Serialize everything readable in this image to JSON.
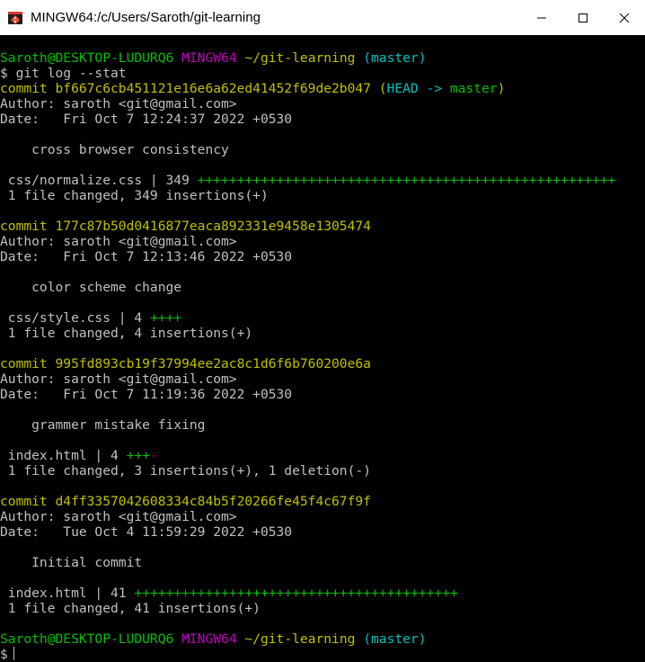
{
  "window": {
    "title": "MINGW64:/c/Users/Saroth/git-learning",
    "minimize_icon": "minimize-icon",
    "maximize_icon": "maximize-icon",
    "close_icon": "close-icon"
  },
  "colors": {
    "prompt_user": "#00c000",
    "prompt_shell": "#c000c0",
    "prompt_path": "#c0c000",
    "prompt_branch": "#00c0c0",
    "commit_hash": "#c0c000",
    "head_ref": "#00c0c0",
    "insertions": "#00c000",
    "deletions": "#c00000"
  },
  "prompt": {
    "user_host": "Saroth@DESKTOP-LUDURQ6",
    "shell": "MINGW64",
    "path": "~/git-learning",
    "branch": "(master)"
  },
  "command": "$ git log --stat",
  "head_label_open": "(",
  "head_label": "HEAD -> ",
  "head_branch": "master",
  "head_label_close": ")",
  "commits": [
    {
      "commit_line": "commit bf667c6cb451121e16e6a62ed41452f69de2b047",
      "author": "Author: saroth <git@gmail.com>",
      "date": "Date:   Fri Oct 7 12:24:37 2022 +0530",
      "message": "    cross browser consistency",
      "stat_prefix": " css/normalize.css | 349 ",
      "stat_plus": "+++++++++++++++++++++++++++++++++++++++++++++++++++++",
      "stat_minus": "",
      "summary": " 1 file changed, 349 insertions(+)"
    },
    {
      "commit_line": "commit 177c87b50d0416877eaca892331e9458e1305474",
      "author": "Author: saroth <git@gmail.com>",
      "date": "Date:   Fri Oct 7 12:13:46 2022 +0530",
      "message": "    color scheme change",
      "stat_prefix": " css/style.css | 4 ",
      "stat_plus": "++++",
      "stat_minus": "",
      "summary": " 1 file changed, 4 insertions(+)"
    },
    {
      "commit_line": "commit 995fd893cb19f37994ee2ac8c1d6f6b760200e6a",
      "author": "Author: saroth <git@gmail.com>",
      "date": "Date:   Fri Oct 7 11:19:36 2022 +0530",
      "message": "    grammer mistake fixing",
      "stat_prefix": " index.html | 4 ",
      "stat_plus": "+++",
      "stat_minus": "-",
      "summary": " 1 file changed, 3 insertions(+), 1 deletion(-)"
    },
    {
      "commit_line": "commit d4ff3357042608334c84b5f20266fe45f4c67f9f",
      "author": "Author: saroth <git@gmail.com>",
      "date": "Date:   Tue Oct 4 11:59:29 2022 +0530",
      "message": "    Initial commit",
      "stat_prefix": " index.html | 41 ",
      "stat_plus": "+++++++++++++++++++++++++++++++++++++++++",
      "stat_minus": "",
      "summary": " 1 file changed, 41 insertions(+)"
    }
  ],
  "final_prompt_char": "$"
}
